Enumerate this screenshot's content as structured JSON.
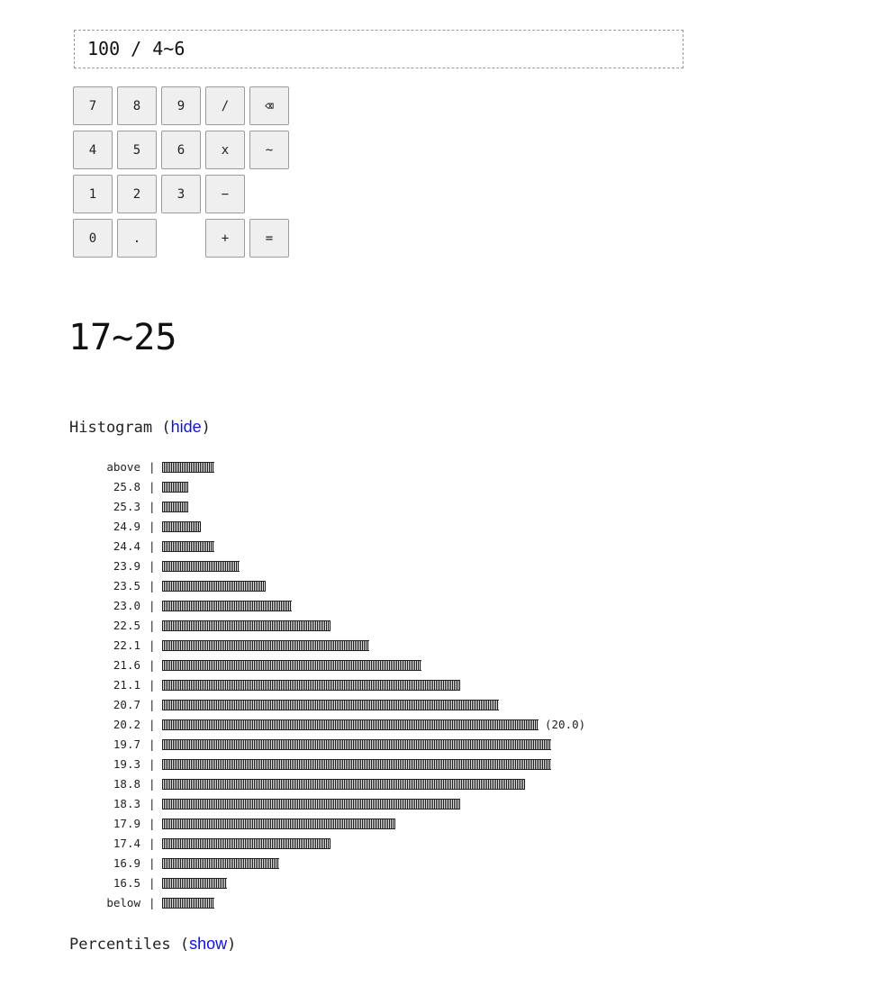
{
  "display": {
    "expression": "100 / 4~6"
  },
  "keypad": {
    "keys": [
      {
        "label": "7",
        "name": "key-7"
      },
      {
        "label": "8",
        "name": "key-8"
      },
      {
        "label": "9",
        "name": "key-9"
      },
      {
        "label": "/",
        "name": "key-divide"
      },
      {
        "label": "⌫",
        "name": "backspace-icon"
      },
      {
        "label": "4",
        "name": "key-4"
      },
      {
        "label": "5",
        "name": "key-5"
      },
      {
        "label": "6",
        "name": "key-6"
      },
      {
        "label": "x",
        "name": "key-multiply"
      },
      {
        "label": "~",
        "name": "key-range"
      },
      {
        "label": "1",
        "name": "key-1"
      },
      {
        "label": "2",
        "name": "key-2"
      },
      {
        "label": "3",
        "name": "key-3"
      },
      {
        "label": "−",
        "name": "key-minus"
      },
      {
        "label": "0",
        "name": "key-0"
      },
      {
        "label": ".",
        "name": "key-decimal"
      },
      {
        "label": "+",
        "name": "key-plus"
      },
      {
        "label": "=",
        "name": "key-equals"
      }
    ]
  },
  "result": {
    "value": "17~25"
  },
  "histogram_section": {
    "title": "Histogram",
    "open": "(",
    "toggle": "hide",
    "close": ")"
  },
  "percentiles_section": {
    "title": "Percentiles",
    "open": "(",
    "toggle": "show",
    "close": ")"
  },
  "chart_data": {
    "type": "bar",
    "orientation": "horizontal",
    "separator": "|",
    "max_annotation": "(20.0)",
    "categories": [
      "above",
      "25.8",
      "25.3",
      "24.9",
      "24.4",
      "23.9",
      "23.5",
      "23.0",
      "22.5",
      "22.1",
      "21.6",
      "21.1",
      "20.7",
      "20.2",
      "19.7",
      "19.3",
      "18.8",
      "18.3",
      "17.9",
      "17.4",
      "16.9",
      "16.5",
      "below"
    ],
    "values": [
      4.0,
      2.0,
      2.0,
      3.0,
      4.0,
      6.0,
      8.0,
      10.0,
      13.0,
      16.0,
      20.0,
      23.0,
      26.0,
      29.0,
      30.0,
      30.0,
      28.0,
      23.0,
      18.0,
      13.0,
      9.0,
      5.0,
      4.0
    ],
    "annotated_category": "20.2"
  }
}
